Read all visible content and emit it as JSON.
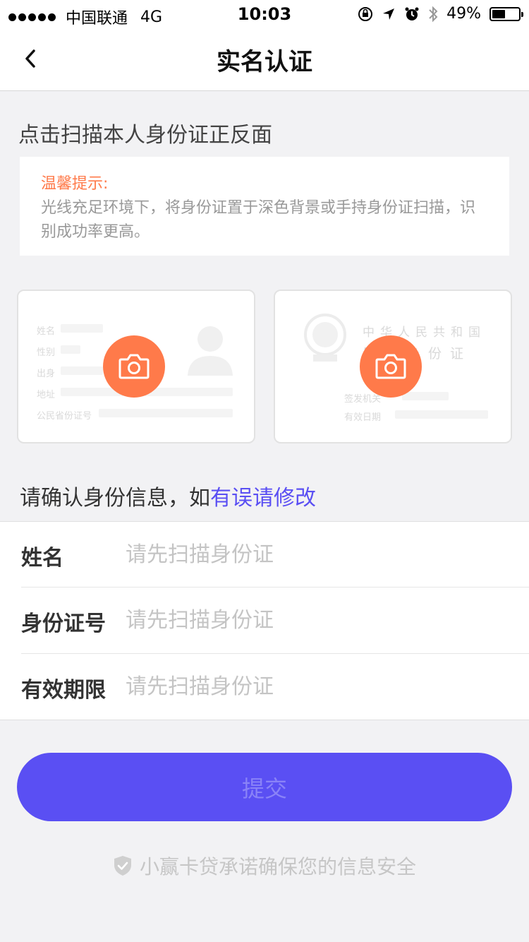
{
  "status_bar": {
    "carrier": "中国联通",
    "network": "4G",
    "time": "10:03",
    "battery_percent": "49%",
    "battery_level": 0.49
  },
  "nav": {
    "title": "实名认证",
    "back_icon": "chevron-left-icon"
  },
  "scan_section": {
    "title": "点击扫描本人身份证正反面"
  },
  "tip": {
    "heading": "温馨提示:",
    "body": "光线充足环境下，将身份证置于深色背景或手持身份证扫描，识别成功率更高。"
  },
  "id_front": {
    "labels": [
      "姓名",
      "性别",
      "出身",
      "地址",
      "公民省份证号"
    ],
    "camera_icon": "camera-icon"
  },
  "id_back": {
    "title_line1": "中华人民共和国",
    "title_line2": "居民身份证",
    "labels": [
      "签发机关",
      "有效日期"
    ],
    "camera_icon": "camera-icon"
  },
  "confirm": {
    "text": "请确认身份信息，如",
    "link": "有误请修改"
  },
  "form": {
    "fields": [
      {
        "label": "姓名",
        "placeholder": "请先扫描身份证",
        "value": ""
      },
      {
        "label": "身份证号",
        "placeholder": "请先扫描身份证",
        "value": ""
      },
      {
        "label": "有效期限",
        "placeholder": "请先扫描身份证",
        "value": ""
      }
    ]
  },
  "submit": {
    "label": "提交"
  },
  "footer": {
    "promise": "小赢卡贷承诺确保您的信息安全",
    "icon": "shield-check-icon"
  },
  "colors": {
    "accent": "#5a4ff3",
    "orange": "#ff7a4a",
    "background": "#f2f2f4"
  }
}
